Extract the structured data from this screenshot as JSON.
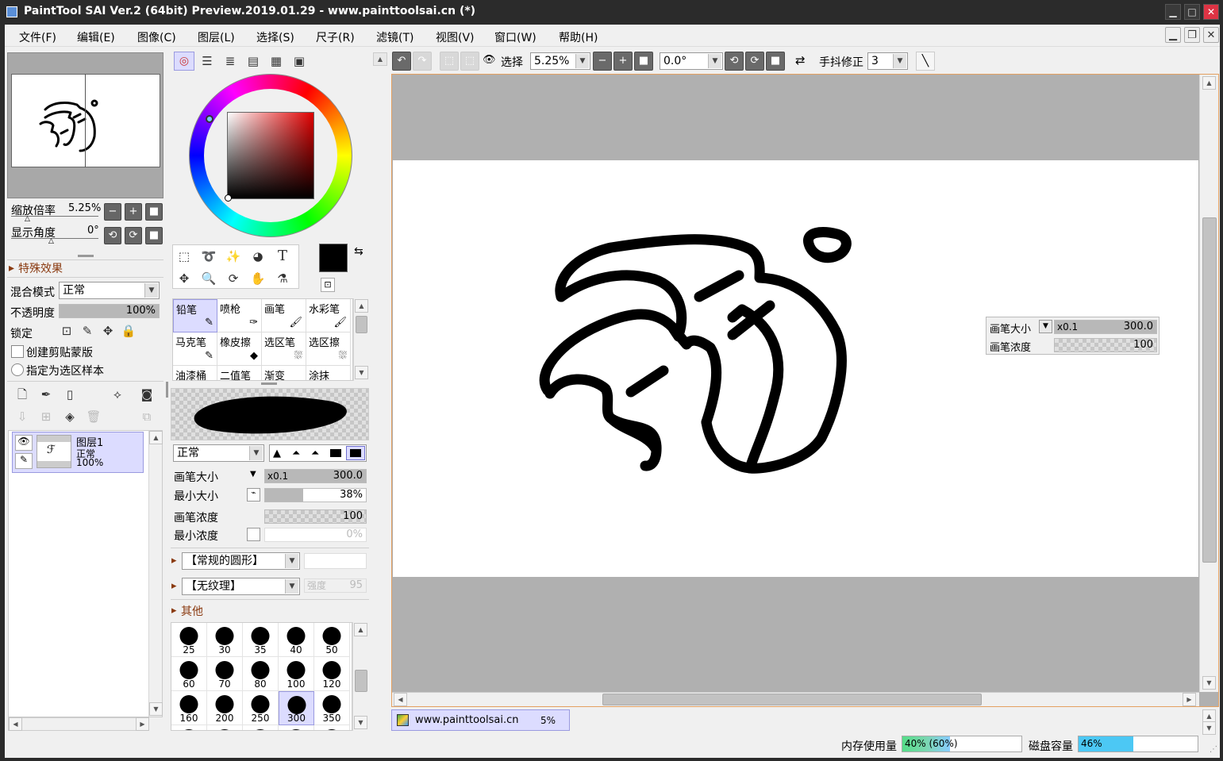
{
  "window": {
    "title": "PaintTool SAI Ver.2 (64bit) Preview.2019.01.29 - www.painttoolsai.cn (*)"
  },
  "menu": [
    "文件(F)",
    "编辑(E)",
    "图像(C)",
    "图层(L)",
    "选择(S)",
    "尺子(R)",
    "滤镜(T)",
    "视图(V)",
    "窗口(W)",
    "帮助(H)"
  ],
  "navigator": {
    "zoom_label": "缩放倍率",
    "zoom_value": "5.25%",
    "angle_label": "显示角度",
    "angle_value": "0°"
  },
  "effects": {
    "header": "特殊效果"
  },
  "layer_props": {
    "blend_label": "混合模式",
    "blend_value": "正常",
    "opacity_label": "不透明度",
    "opacity_value": "100%",
    "lock_label": "锁定",
    "clip_label": "创建剪贴蒙版",
    "sample_label": "指定为选区样本"
  },
  "layers": [
    {
      "name": "图层1",
      "mode": "正常",
      "opacity": "100%"
    }
  ],
  "tools": [
    {
      "name": "铅笔",
      "icon": "pencil-icon",
      "selected": true
    },
    {
      "name": "喷枪",
      "icon": "airbrush-icon"
    },
    {
      "name": "画笔",
      "icon": "brush-icon"
    },
    {
      "name": "水彩笔",
      "icon": "watercolor-icon"
    },
    {
      "name": "马克笔",
      "icon": "marker-icon"
    },
    {
      "name": "橡皮擦",
      "icon": "eraser-icon"
    },
    {
      "name": "选区笔",
      "icon": "select-pen-icon"
    },
    {
      "name": "选区擦",
      "icon": "select-eraser-icon"
    },
    {
      "name": "油漆桶",
      "icon": "bucket-icon"
    },
    {
      "name": "二值笔",
      "icon": "binary-pen-icon"
    },
    {
      "name": "渐变",
      "icon": "gradient-icon"
    },
    {
      "name": "涂抹",
      "icon": "smudge-icon"
    }
  ],
  "brush": {
    "mode": "正常",
    "size_label": "画笔大小",
    "size_mult": "x0.1",
    "size_value": "300.0",
    "min_size_label": "最小大小",
    "min_size_value": "38%",
    "min_size_fraction": 0.38,
    "density_label": "画笔浓度",
    "density_value": "100",
    "min_density_label": "最小浓度",
    "min_density_value": "0%",
    "shape": "【常规的圆形】",
    "texture": "【无纹理】",
    "texture_strength_label": "强度",
    "texture_strength_value": "95",
    "other_label": "其他",
    "presets": [
      "25",
      "30",
      "35",
      "40",
      "50",
      "60",
      "70",
      "80",
      "100",
      "120",
      "160",
      "200",
      "250",
      "300",
      "350"
    ],
    "selected_preset": "300"
  },
  "toolbar": {
    "select_label": "选择",
    "zoom": "5.25%",
    "angle": "0.0°",
    "stabilizer_label": "手抖修正",
    "stabilizer_value": "3"
  },
  "canvas_overlay": {
    "size_label": "画笔大小",
    "size_mult": "x0.1",
    "size_value": "300.0",
    "density_label": "画笔浓度",
    "density_value": "100"
  },
  "doc_tab": {
    "name": "www.painttoolsai.cn",
    "zoom": "5%"
  },
  "status": {
    "memory_label": "内存使用量",
    "memory_value": "40% (60%)",
    "memory_fraction": 0.4,
    "disk_label": "磁盘容量",
    "disk_value": "46%",
    "disk_fraction": 0.46
  }
}
